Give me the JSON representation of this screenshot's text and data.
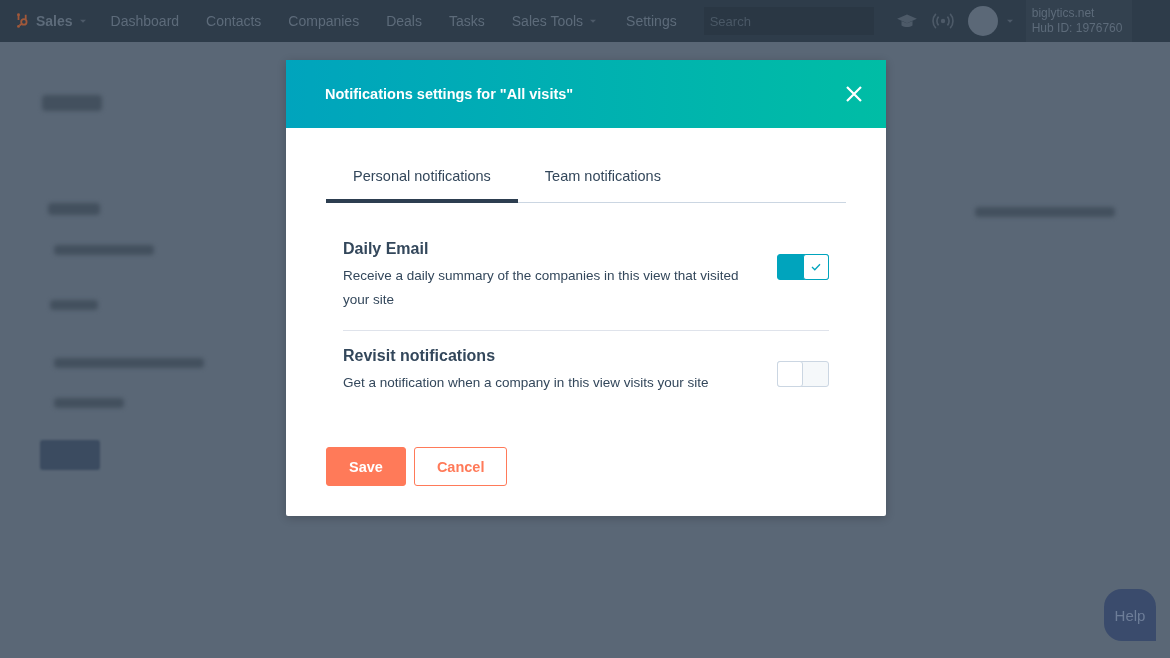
{
  "nav": {
    "brand": "Sales",
    "items": [
      {
        "label": "Dashboard",
        "has_menu": false
      },
      {
        "label": "Contacts",
        "has_menu": false
      },
      {
        "label": "Companies",
        "has_menu": false
      },
      {
        "label": "Deals",
        "has_menu": false
      },
      {
        "label": "Tasks",
        "has_menu": false
      },
      {
        "label": "Sales Tools",
        "has_menu": true
      },
      {
        "label": "Settings",
        "has_menu": false
      }
    ],
    "search": {
      "placeholder": "Search"
    },
    "account": {
      "domain": "biglytics.net",
      "hub_id": "Hub ID: 1976760"
    }
  },
  "modal": {
    "title": "Notifications settings for \"All visits\"",
    "tabs": [
      {
        "label": "Personal notifications",
        "selected": true
      },
      {
        "label": "Team notifications",
        "selected": false
      }
    ],
    "settings": [
      {
        "title": "Daily Email",
        "description": "Receive a daily summary of the companies in this view that visited your site",
        "on": true
      },
      {
        "title": "Revisit notifications",
        "description": "Get a notification when a company in this view visits your site",
        "on": false
      }
    ],
    "buttons": [
      {
        "label": "Save",
        "kind": "primary"
      },
      {
        "label": "Cancel",
        "kind": "secondary"
      }
    ]
  },
  "help": {
    "label": "Help"
  }
}
